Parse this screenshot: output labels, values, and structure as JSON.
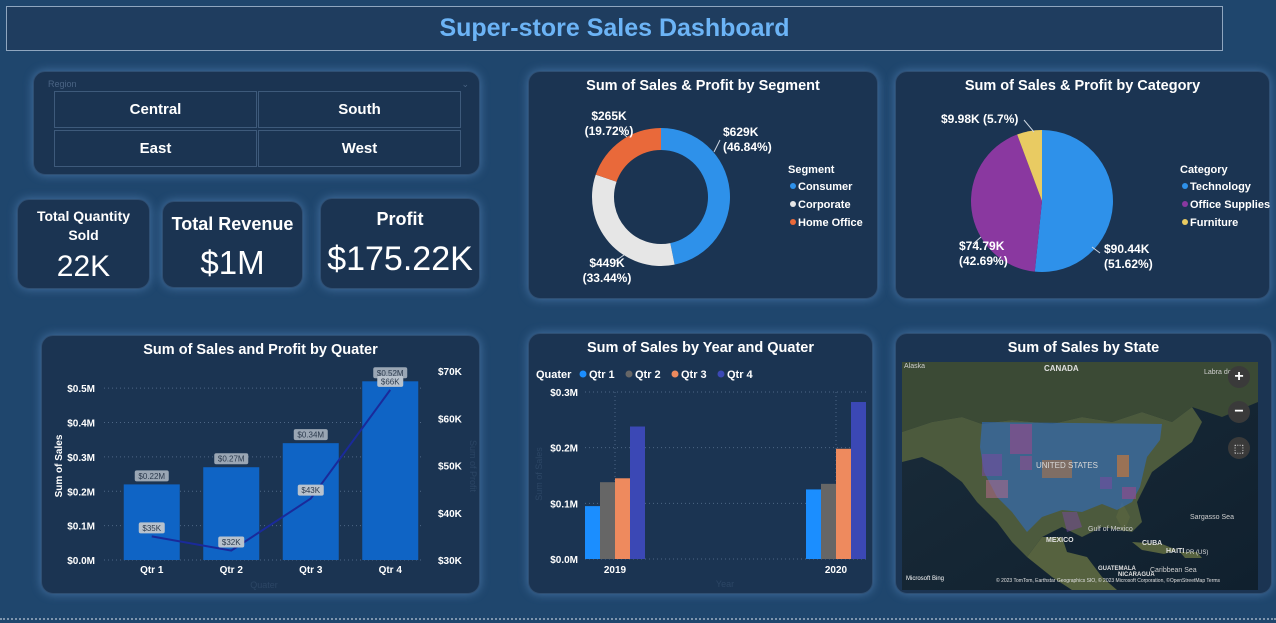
{
  "page": {
    "title": "Super-store Sales Dashboard"
  },
  "colors": {
    "background": "#1f466d",
    "card": "#1b3452",
    "title": "#6cb4f6",
    "bar_blue": "#0f64c5",
    "line_navy": "#1a2a9a",
    "consumer": "#2e91ea",
    "corporate": "#e6e6e6",
    "home_office": "#e9693a",
    "technology": "#2e91ea",
    "office_supplies": "#8a38a0",
    "furniture": "#e9cb62",
    "qtr1": "#1b8eff",
    "qtr2": "#666666",
    "qtr3": "#ee8a5e",
    "qtr4": "#3b48b5"
  },
  "slicer": {
    "title": "Region",
    "options": [
      "Central",
      "South",
      "East",
      "West"
    ]
  },
  "kpis": {
    "quantity": {
      "label_line1": "Total Quantity",
      "label_line2": "Sold",
      "value": "22K"
    },
    "revenue": {
      "label": "Total Revenue",
      "value": "$1M"
    },
    "profit": {
      "label": "Profit",
      "value": "$175.22K"
    }
  },
  "map": {
    "title": "Sum of Sales by State",
    "labels": {
      "alaska": "Alaska",
      "canada": "CANADA",
      "labrador": "Labra dor",
      "us": "UNITED STATES",
      "gulf": "Gulf of Mexico",
      "mexico": "MEXICO",
      "cuba": "CUBA",
      "haiti": "HAITI",
      "pr": "PR (US)",
      "sargasso": "Sargasso Sea",
      "caribbean": "Caribbean Sea",
      "guatemala": "GUATEMALA",
      "nicaragua": "NICARAGUA",
      "bing": "Microsoft Bing",
      "attribution": "© 2023 TomTom, Earthstar Geographics SIO, © 2023 Microsoft Corporation, ©OpenStreetMap  Terms"
    },
    "controls": [
      "zoom-in-icon",
      "zoom-out-icon",
      "select-icon"
    ]
  },
  "chart_data": [
    {
      "id": "segment",
      "type": "pie",
      "title": "Sum of Sales & Profit by Segment",
      "legend_title": "Segment",
      "legend_position": "right",
      "donut": true,
      "slices": [
        {
          "name": "Consumer",
          "value": 629,
          "label": "$629K",
          "pct": "(46.84%)",
          "color": "#2e91ea"
        },
        {
          "name": "Corporate",
          "value": 449,
          "label": "$449K",
          "pct": "(33.44%)",
          "color": "#e6e6e6"
        },
        {
          "name": "Home Office",
          "value": 265,
          "label": "$265K",
          "pct": "(19.72%)",
          "color": "#e9693a"
        }
      ]
    },
    {
      "id": "category",
      "type": "pie",
      "title": "Sum of Sales & Profit by Category",
      "legend_title": "Category",
      "legend_position": "right",
      "donut": false,
      "slices": [
        {
          "name": "Technology",
          "value": 90.44,
          "label": "$90.44K",
          "pct": "(51.62%)",
          "color": "#2e91ea"
        },
        {
          "name": "Office Supplies",
          "value": 74.79,
          "label": "$74.79K",
          "pct": "(42.69%)",
          "color": "#8a38a0"
        },
        {
          "name": "Furniture",
          "value": 9.98,
          "label": "$9.98K (5.7%)",
          "pct": "",
          "color": "#e9cb62"
        }
      ]
    },
    {
      "id": "quarter",
      "type": "bar",
      "title": "Sum of Sales and Profit by Quater",
      "xlabel": "Quater",
      "ylabel": "Sum of Sales",
      "y2label": "Sum of Profit",
      "categories": [
        "Qtr 1",
        "Qtr 2",
        "Qtr 3",
        "Qtr 4"
      ],
      "ylim": [
        0,
        0.55
      ],
      "yticks": [
        "$0.0M",
        "$0.1M",
        "$0.2M",
        "$0.3M",
        "$0.4M",
        "$0.5M"
      ],
      "y2lim": [
        30,
        70
      ],
      "y2ticks": [
        "$30K",
        "$40K",
        "$50K",
        "$60K",
        "$70K"
      ],
      "series": [
        {
          "name": "Sum of Sales",
          "kind": "bar",
          "values": [
            0.22,
            0.27,
            0.34,
            0.52
          ],
          "labels": [
            "$0.22M",
            "$0.27M",
            "$0.34M",
            "$0.52M"
          ]
        },
        {
          "name": "Sum of Profit",
          "kind": "line",
          "values": [
            35,
            32,
            43,
            66
          ],
          "labels": [
            "$35K",
            "$32K",
            "$43K",
            "$66K"
          ]
        }
      ]
    },
    {
      "id": "year_quarter",
      "type": "bar",
      "title": "Sum of Sales by Year and Quater",
      "legend_title": "Quater",
      "legend_position": "top-left",
      "xlabel": "Year",
      "ylabel": "Sum of Sales",
      "categories": [
        "2019",
        "2020"
      ],
      "ylim": [
        0,
        0.3
      ],
      "yticks": [
        "$0.0M",
        "$0.1M",
        "$0.2M",
        "$0.3M"
      ],
      "series": [
        {
          "name": "Qtr 1",
          "values": [
            0.095,
            0.125
          ],
          "color": "#1b8eff"
        },
        {
          "name": "Qtr 2",
          "values": [
            0.138,
            0.135
          ],
          "color": "#666666"
        },
        {
          "name": "Qtr 3",
          "values": [
            0.145,
            0.198
          ],
          "color": "#ee8a5e"
        },
        {
          "name": "Qtr 4",
          "values": [
            0.238,
            0.282
          ],
          "color": "#3b48b5"
        }
      ]
    }
  ]
}
